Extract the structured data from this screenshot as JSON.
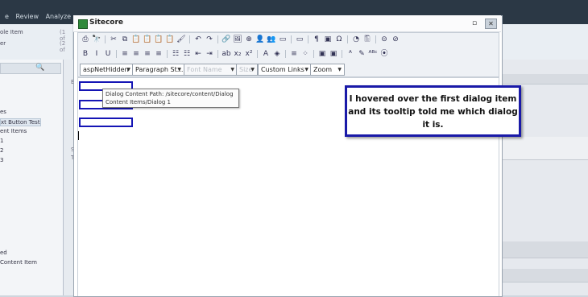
{
  "background": {
    "ribbon_tabs": [
      "e",
      "Review",
      "Analyze"
    ],
    "ribbon_items": [
      {
        "label": "ole Item",
        "count": "(1 of"
      },
      {
        "label": "er",
        "count": "(2 of"
      }
    ],
    "tree_items": [
      "es",
      "xt Button Test",
      "ent Items",
      "1",
      "2",
      "3"
    ],
    "bottom_items": [
      "ed",
      "Content Item"
    ],
    "mid_letters": [
      "B",
      "S",
      "T"
    ]
  },
  "dialog": {
    "title": "Sitecore",
    "minimize_glyph": "▫",
    "close_glyph": "✕",
    "toolbar_row1": [
      "⎙",
      "🔭",
      "✂",
      "⧉",
      "📋",
      "📋",
      "📋",
      "📋",
      "🖌",
      "↶",
      "↷",
      "🔗",
      "🖼",
      "⊕",
      "👤",
      "👥",
      "▭",
      "▭",
      "¶",
      "▣",
      "Ω",
      "◔",
      "🖺",
      "⊝",
      "⊘"
    ],
    "toolbar_row2": [
      "B",
      "I",
      "U",
      "≡",
      "≡",
      "≡",
      "≡",
      "☷",
      "☷",
      "⇤",
      "⇥",
      "ab",
      "x₂",
      "x²",
      "A",
      "◈",
      "≡",
      "⁘",
      "▣",
      "▣",
      "ᴬ",
      "✎",
      "ᴬᴮᶜ",
      "⦿"
    ],
    "combos": {
      "class": "aspNetHidden",
      "paragraph": "Paragraph St...",
      "font_name": "Font Name",
      "size": "Size",
      "links": "Custom Links",
      "zoom": "Zoom"
    }
  },
  "tooltip": {
    "line1": "Dialog Content Path: /sitecore/content/Dialog",
    "line2": "Content Items/Dialog 1"
  },
  "annotation": {
    "text": "I hovered over the first dialog item and its tooltip told me which dialog it is."
  }
}
